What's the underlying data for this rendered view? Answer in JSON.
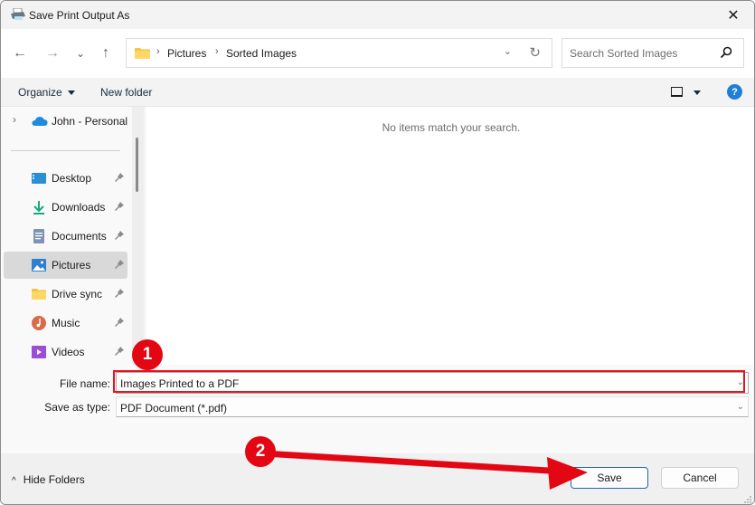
{
  "window": {
    "title": "Save Print Output As",
    "close_glyph": "✕"
  },
  "nav": {
    "back_glyph": "←",
    "forward_glyph": "→",
    "recent_glyph": "⌄",
    "up_glyph": "↑",
    "breadcrumb": [
      "Pictures",
      "Sorted Images"
    ],
    "separator": "›",
    "dropdown_glyph": "⌄",
    "refresh_glyph": "↻"
  },
  "search": {
    "placeholder": "Search Sorted Images"
  },
  "toolbar": {
    "organize_label": "Organize",
    "new_folder_label": "New folder",
    "help_glyph": "?"
  },
  "sidebar": {
    "expand_glyph": "›",
    "onedrive_label": "John - Personal",
    "items": [
      {
        "label": "Desktop",
        "icon": "desktop-icon",
        "pinned": true,
        "selected": false
      },
      {
        "label": "Downloads",
        "icon": "downloads-icon",
        "pinned": true,
        "selected": false
      },
      {
        "label": "Documents",
        "icon": "documents-icon",
        "pinned": true,
        "selected": false
      },
      {
        "label": "Pictures",
        "icon": "pictures-icon",
        "pinned": true,
        "selected": true
      },
      {
        "label": "Drive sync",
        "icon": "folder-icon",
        "pinned": true,
        "selected": false
      },
      {
        "label": "Music",
        "icon": "music-icon",
        "pinned": true,
        "selected": false
      },
      {
        "label": "Videos",
        "icon": "videos-icon",
        "pinned": true,
        "selected": false
      }
    ]
  },
  "content": {
    "empty_message": "No items match your search."
  },
  "form": {
    "file_name_label": "File name:",
    "file_name_value": "Images Printed to a PDF",
    "save_type_label": "Save as type:",
    "save_type_value": "PDF Document (*.pdf)",
    "dropdown_glyph": "⌄"
  },
  "footer": {
    "hide_folders_label": "Hide Folders",
    "hide_folders_glyph": "^",
    "save_label": "Save",
    "cancel_label": "Cancel"
  },
  "annotations": {
    "step1": "1",
    "step2": "2",
    "color": "#e30613"
  }
}
